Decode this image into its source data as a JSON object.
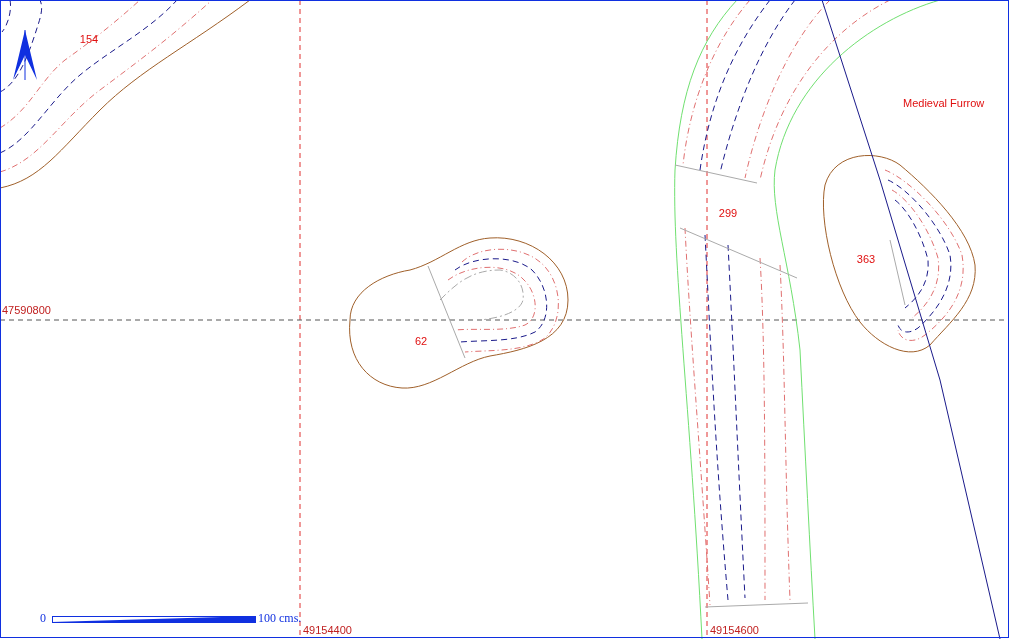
{
  "features": [
    {
      "label": "154"
    },
    {
      "label": "62"
    },
    {
      "label": "299"
    },
    {
      "label": "363"
    }
  ],
  "annotations": [
    "Medieval Furrow"
  ],
  "grid": {
    "northing_labels": [
      "47590800"
    ],
    "easting_labels": [
      "49154400",
      "49154600"
    ]
  },
  "scale_bar": {
    "start": "0",
    "end": "100",
    "unit": "cms."
  }
}
